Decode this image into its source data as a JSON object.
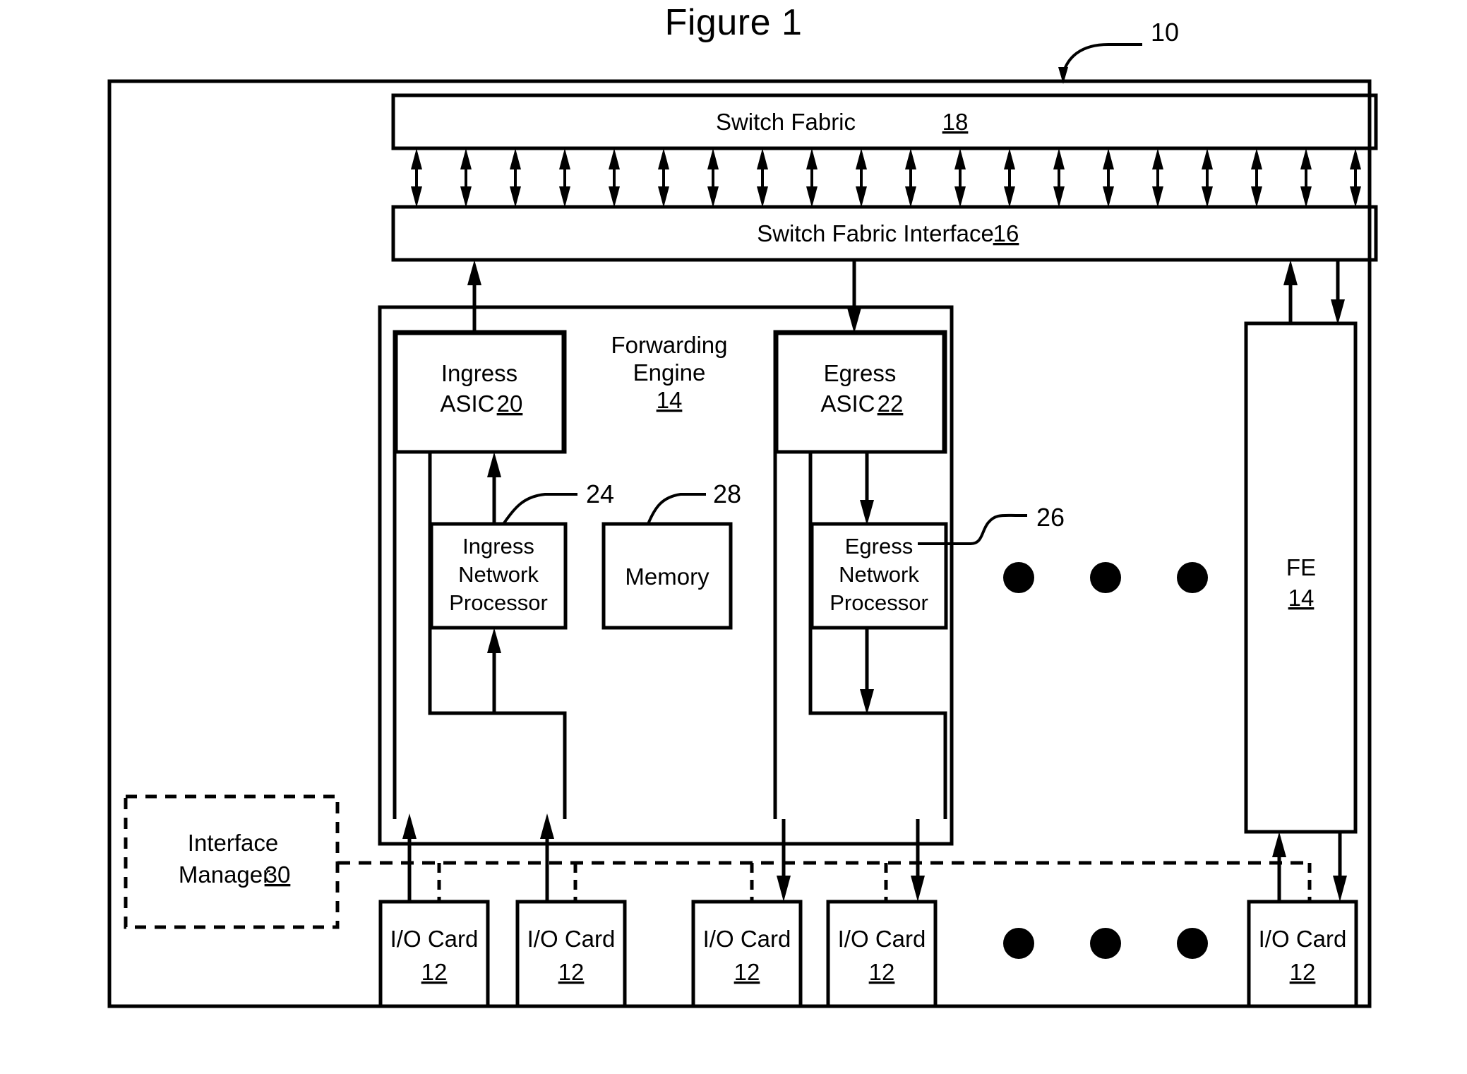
{
  "figure": {
    "title": "Figure 1",
    "system_ref": "10"
  },
  "blocks": {
    "switch_fabric": {
      "label": "Switch Fabric",
      "ref": "18"
    },
    "switch_fabric_interface": {
      "label": "Switch Fabric Interface",
      "ref": "16"
    },
    "forwarding_engine": {
      "line1": "Forwarding",
      "line2": "Engine",
      "ref": "14"
    },
    "ingress_asic": {
      "line1": "Ingress",
      "line2": "ASIC",
      "ref": "20"
    },
    "egress_asic": {
      "line1": "Egress",
      "line2": "ASIC",
      "ref": "22"
    },
    "ingress_network_processor": {
      "line1": "Ingress",
      "line2": "Network",
      "line3": "Processor",
      "ref": "24"
    },
    "egress_network_processor": {
      "line1": "Egress",
      "line2": "Network",
      "line3": "Processor",
      "ref": "26"
    },
    "memory": {
      "label": "Memory",
      "ref": "28"
    },
    "fe_right": {
      "label": "FE",
      "ref": "14"
    },
    "interface_manager": {
      "line1": "Interface",
      "line2": "Manager",
      "ref": "30"
    }
  },
  "io_cards": [
    {
      "label": "I/O Card",
      "ref": "12"
    },
    {
      "label": "I/O Card",
      "ref": "12"
    },
    {
      "label": "I/O Card",
      "ref": "12"
    },
    {
      "label": "I/O Card",
      "ref": "12"
    },
    {
      "label": "I/O Card",
      "ref": "12"
    }
  ],
  "ellipsis_groups": {
    "middle_row_dots": 3,
    "bottom_row_dots": 3
  },
  "fabric_links": {
    "count": 20,
    "type": "bidirectional"
  },
  "colors": {
    "ink": "#000000",
    "background": "#ffffff"
  }
}
